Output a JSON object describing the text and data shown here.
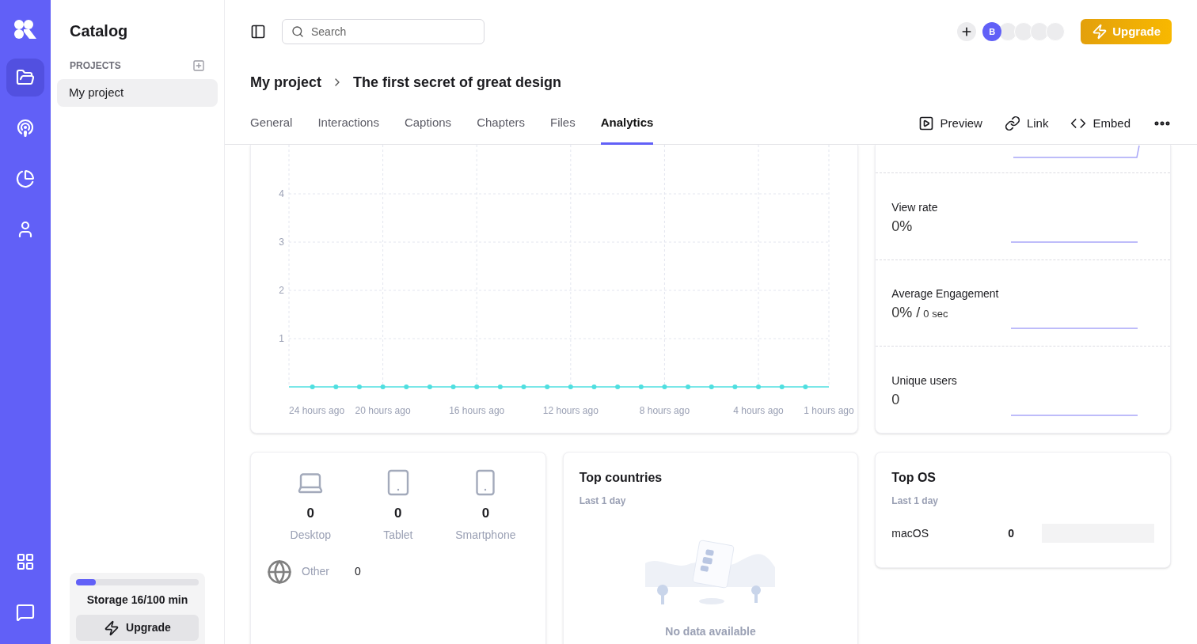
{
  "rail": {
    "items": [
      {
        "kind": "folder",
        "selected": true
      },
      {
        "kind": "broadcast",
        "selected": false
      },
      {
        "kind": "pie",
        "selected": false
      },
      {
        "kind": "person",
        "selected": false
      }
    ],
    "bottom": [
      {
        "kind": "apps",
        "selected": false
      },
      {
        "kind": "chat",
        "selected": false
      }
    ]
  },
  "sidebar": {
    "title": "Catalog",
    "section": "PROJECTS",
    "projects": [
      {
        "label": "My project",
        "selected": true
      }
    ],
    "storage": {
      "level": 0.16,
      "label": "Storage 16/100 min",
      "button": "Upgrade"
    }
  },
  "topbar": {
    "search": {
      "placeholder": "Search"
    },
    "avatar": "B",
    "upgrade": "Upgrade"
  },
  "breadcrumb": [
    "My project",
    "The first secret of great design"
  ],
  "tabs": [
    {
      "label": "General",
      "selected": false
    },
    {
      "label": "Interactions",
      "selected": false
    },
    {
      "label": "Captions",
      "selected": false
    },
    {
      "label": "Chapters",
      "selected": false
    },
    {
      "label": "Files",
      "selected": false
    },
    {
      "label": "Analytics",
      "selected": true
    }
  ],
  "actions": [
    {
      "kind": "preview",
      "label": "Preview"
    },
    {
      "kind": "link",
      "label": "Link"
    },
    {
      "kind": "embed",
      "label": "Embed"
    }
  ],
  "chart": {
    "chart_data": {
      "type": "line",
      "x": [
        -24,
        -23,
        -22,
        -21,
        -20,
        -19,
        -18,
        -17,
        -16,
        -15,
        -14,
        -13,
        -12,
        -11,
        -10,
        -9,
        -8,
        -7,
        -6,
        -5,
        -4,
        -3,
        -2,
        -1
      ],
      "series": [
        {
          "color": "#4fdfe0",
          "marker": true,
          "values": [
            0,
            0,
            0,
            0,
            0,
            0,
            0,
            0,
            0,
            0,
            0,
            0,
            0,
            0,
            0,
            0,
            0,
            0,
            0,
            0,
            0,
            0,
            0,
            0
          ]
        }
      ],
      "grid": true,
      "xlim": [
        -24,
        -1
      ],
      "ylim": [
        0,
        5
      ],
      "yticks": [
        1,
        2,
        3,
        4
      ],
      "xticks": [
        {
          "value": -24,
          "label": "24 hours ago"
        },
        {
          "value": -20,
          "label": "20 hours ago"
        },
        {
          "value": -16,
          "label": "16 hours ago"
        },
        {
          "value": -12,
          "label": "12 hours ago"
        },
        {
          "value": -8,
          "label": "8 hours ago"
        },
        {
          "value": -4,
          "label": "4 hours ago"
        },
        {
          "value": -1,
          "label": "1 hours ago"
        }
      ]
    }
  },
  "stats": [
    {
      "label": "View rate",
      "value": "0%"
    },
    {
      "label": "Average Engagement",
      "value": "0% /",
      "secondary": "0 sec"
    },
    {
      "label": "Unique users",
      "value": "0"
    }
  ],
  "devices": [
    {
      "kind": "desktop",
      "count": "0",
      "label": "Desktop"
    },
    {
      "kind": "tablet",
      "count": "0",
      "label": "Tablet"
    },
    {
      "kind": "smartphone",
      "count": "0",
      "label": "Smartphone"
    }
  ],
  "other": {
    "label": "Other",
    "count": "0"
  },
  "top_countries": {
    "title": "Top countries",
    "subtitle": "Last 1 day",
    "empty": "No data available"
  },
  "top_os": {
    "title": "Top OS",
    "subtitle": "Last 1 day",
    "rows": [
      {
        "name": "macOS",
        "count": "0",
        "level": 0
      }
    ]
  }
}
